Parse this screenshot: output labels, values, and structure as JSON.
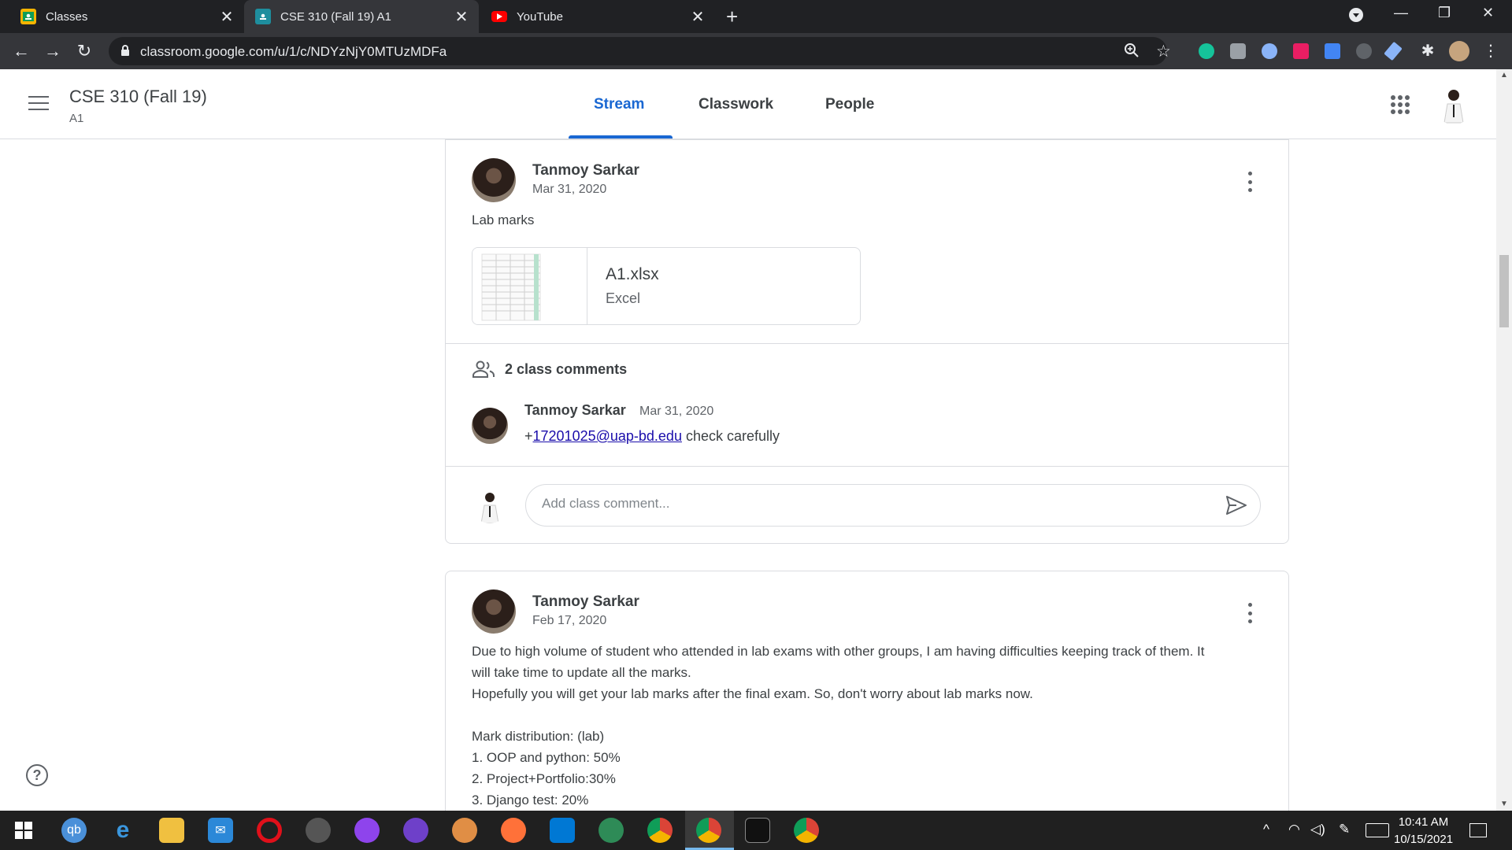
{
  "browser": {
    "tabs": [
      {
        "title": "Classes",
        "favicon_color": "#f4b400",
        "active": false
      },
      {
        "title": "CSE 310 (Fall 19) A1",
        "favicon_color": "#1e8e9e",
        "active": true
      },
      {
        "title": "YouTube",
        "favicon_color": "#ff0000",
        "active": false
      }
    ],
    "url": "classroom.google.com/u/1/c/NDYzNjY0MTUzMDFa"
  },
  "appbar": {
    "course_title": "CSE 310 (Fall 19)",
    "course_section": "A1",
    "tabs": [
      "Stream",
      "Classwork",
      "People"
    ],
    "active_tab": "Stream"
  },
  "posts": [
    {
      "author": "Tanmoy Sarkar",
      "date": "Mar 31, 2020",
      "text": "Lab marks",
      "attachment": {
        "name": "A1.xlsx",
        "type": "Excel"
      },
      "comments_count_label": "2 class comments",
      "comment": {
        "author": "Tanmoy Sarkar",
        "date": "Mar 31, 2020",
        "prefix": "+",
        "mention": "17201025@uap-bd.edu",
        "text": " check carefully"
      },
      "add_comment_placeholder": "Add class comment..."
    },
    {
      "author": "Tanmoy Sarkar",
      "date": "Feb 17, 2020",
      "lines": [
        "Due to high volume of student who attended in lab exams with other groups, I am having difficulties keeping track of them. It",
        "will take time to update all the marks.",
        "Hopefully you will get your lab marks after the final exam. So, don't worry about lab marks now.",
        "",
        "Mark distribution: (lab)",
        "1. OOP and python: 50%",
        "2. Project+Portfolio:30%",
        "3. Django test: 20%"
      ]
    }
  ],
  "help_label": "?",
  "taskbar": {
    "time": "10:41 AM",
    "date": "10/15/2021"
  },
  "colors": {
    "accent": "#1967d2",
    "chrome_dark": "#202124",
    "chrome_toolbar": "#35363a",
    "taskbar": "#202020"
  }
}
